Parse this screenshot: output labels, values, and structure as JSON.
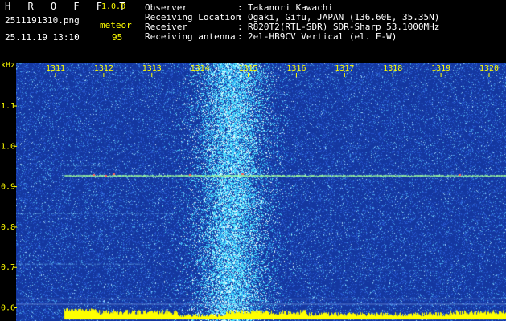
{
  "app": {
    "title": "H R O F F T",
    "version": "1.0.0"
  },
  "file": {
    "name": "2511191310.png",
    "datetime": "25.11.19 13:10"
  },
  "detector": {
    "label": "meteor",
    "count": "95"
  },
  "info": [
    {
      "key": "Observer",
      "sep": ":",
      "value": "Takanori Kawachi"
    },
    {
      "key": "Receiving Location",
      "sep": ":",
      "value": "Ogaki, Gifu, JAPAN (136.60E, 35.35N)"
    },
    {
      "key": "Receiver",
      "sep": ":",
      "value": "R820T2(RTL-SDR) SDR-Sharp 53.1000MHz"
    },
    {
      "key": "Receiving antenna",
      "sep": ":",
      "value": "2el-HB9CV Vertical (el. E-W)"
    }
  ],
  "axis": {
    "unit": "kHz",
    "x_ticks": [
      "1311",
      "1312",
      "1313",
      "1314",
      "1315",
      "1316",
      "1317",
      "1318",
      "1319",
      "1320"
    ],
    "y_ticks": [
      "1.1",
      "1.0",
      "0.9",
      "0.8",
      "0.7",
      "0.6"
    ]
  },
  "colors": {
    "background": "#1a3fa8",
    "text_primary": "#ffffff",
    "text_accent": "#ffff00",
    "tick_labels": "#ffff00",
    "signal_line": "#a0ffa0",
    "meteor_burst": "#00ffff"
  }
}
